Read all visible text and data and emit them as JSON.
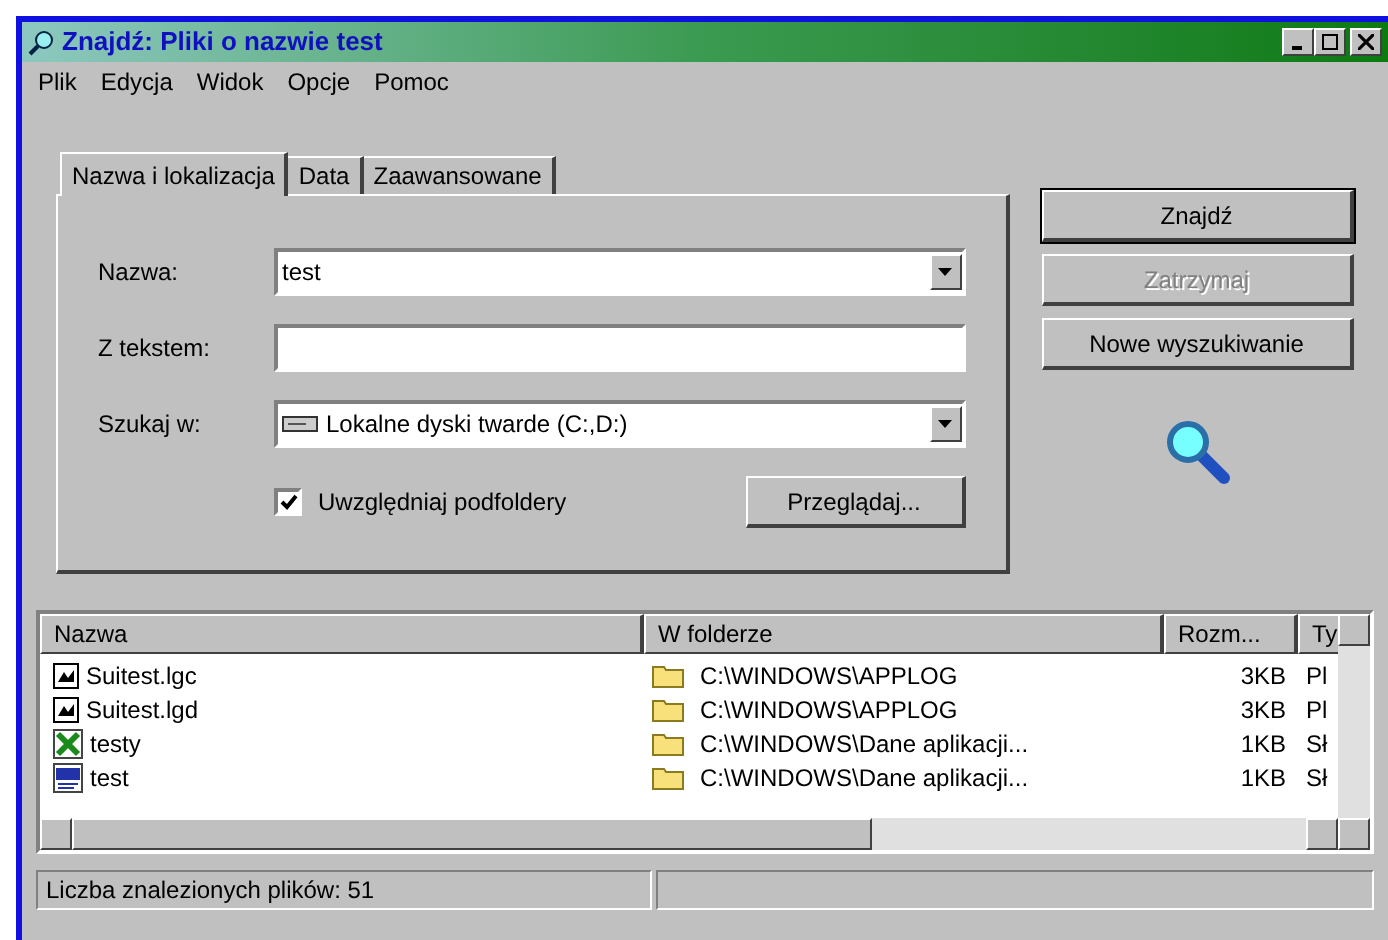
{
  "window": {
    "title": "Znajdź: Pliki o nazwie test"
  },
  "menu": [
    "Plik",
    "Edycja",
    "Widok",
    "Opcje",
    "Pomoc"
  ],
  "tabs": [
    {
      "label": "Nazwa i lokalizacja",
      "selected": true
    },
    {
      "label": "Data",
      "selected": false
    },
    {
      "label": "Zaawansowane",
      "selected": false
    }
  ],
  "form": {
    "name_label": "Nazwa:",
    "name_value": "test",
    "text_label": "Z tekstem:",
    "lookin_label": "Szukaj w:",
    "lookin_value": "Lokalne dyski twarde (C:,D:)",
    "subfolders": {
      "label": "Uwzględniaj podfoldery",
      "checked": true
    },
    "browse": "Przeglądaj..."
  },
  "buttons": [
    {
      "label": "Znajdź",
      "disabled": false
    },
    {
      "label": "Zatrzymaj",
      "disabled": true
    },
    {
      "label": "Nowe wyszukiwanie",
      "disabled": false
    }
  ],
  "table": {
    "columns": [
      "Nazwa",
      "W folderze",
      "Rozm...",
      "Ty"
    ],
    "rows": [
      {
        "kind": "log",
        "name": "Suitest.lgc",
        "folder": "C:\\WINDOWS\\APPLOG",
        "size": "3KB",
        "type": "Pl"
      },
      {
        "kind": "log",
        "name": "Suitest.lgd",
        "folder": "C:\\WINDOWS\\APPLOG",
        "size": "3KB",
        "type": "Pl"
      },
      {
        "kind": "sheet",
        "name": "testy",
        "folder": "C:\\WINDOWS\\Dane aplikacji...",
        "size": "1KB",
        "type": "Sł"
      },
      {
        "kind": "doc",
        "name": "test",
        "folder": "C:\\WINDOWS\\Dane aplikacji...",
        "size": "1KB",
        "type": "Sł"
      }
    ]
  },
  "status_bar": "Liczba znalezionych plików: 51"
}
